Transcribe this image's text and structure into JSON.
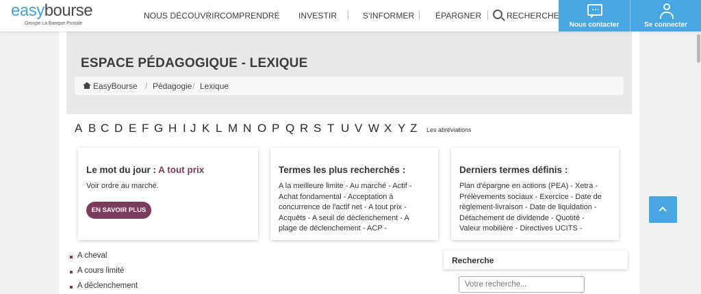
{
  "header": {
    "logo_easy": "easy",
    "logo_bourse": "bourse",
    "logo_sub": "Groupe La Banque Postale",
    "nav": [
      "NOUS DÉCOUVRIR",
      "COMPRENDRE",
      "INVESTIR",
      "S'INFORMER",
      "ÉPARGNER"
    ],
    "search_label": "RECHERCHER",
    "contact_label": "Nous contacter",
    "login_label": "Se connecter"
  },
  "page": {
    "title": "ESPACE PÉDAGOGIQUE - LEXIQUE",
    "breadcrumb": [
      "EasyBourse",
      "Pédagogie",
      "Lexique"
    ],
    "breadcrumb_sep": "/"
  },
  "alphabet": [
    "A",
    "B",
    "C",
    "D",
    "E",
    "F",
    "G",
    "H",
    "I",
    "J",
    "K",
    "L",
    "M",
    "N",
    "O",
    "P",
    "Q",
    "R",
    "S",
    "T",
    "U",
    "V",
    "W",
    "X",
    "Y",
    "Z"
  ],
  "abbreviations_link": "Les abréviations",
  "cards": {
    "word_of_day": {
      "title_prefix": "Le mot du jour : ",
      "title_term": "A tout prix",
      "text": "Voir ordre au marché.",
      "button": "EN SAVOIR PLUS"
    },
    "most_searched": {
      "title": "Termes les plus recherchés :",
      "text": "A la meilleure limite - Au marché - Actif - Achat fondamental - Acceptation à concurrence de l'actif net - A tout prix - Acquêts - A seuil de déclenchement - A plage de déclenchement - ACP -"
    },
    "last_defined": {
      "title": "Derniers termes définis :",
      "text": "Plan d'épargne en actions (PEA) - Xetra - Prélèvements sociaux - Exercice - Date de règlement-livraison - Date de liquidation - Détachement de dividende - Quotité - Valeur mobilière - Directives UCITS -"
    }
  },
  "terms": [
    "A cheval",
    "A cours limité",
    "A déclenchement"
  ],
  "search": {
    "title": "Recherche",
    "placeholder": "Votre recherche..."
  },
  "colors": {
    "accent_blue": "#48a6e2",
    "accent_plum": "#7b3b5c"
  }
}
